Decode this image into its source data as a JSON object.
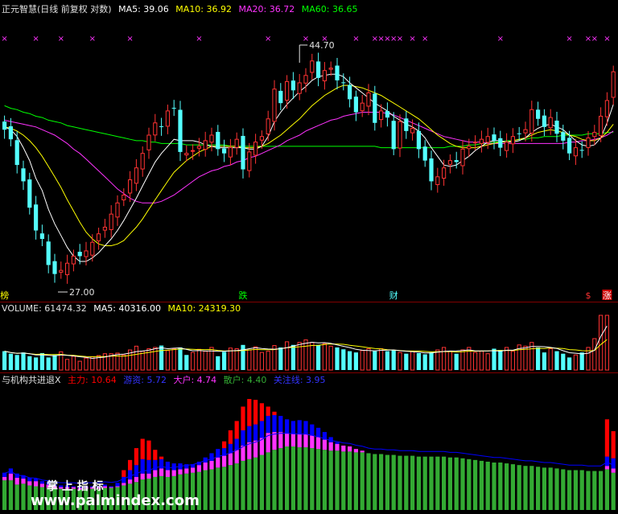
{
  "colors": {
    "up": "#ff3333",
    "down": "#54ffff",
    "ma5": "#ffffff",
    "ma10": "#ffff00",
    "ma20": "#ff33ff",
    "ma60": "#00ff00",
    "label": "#e0e0e0",
    "main": "#ff0000",
    "retail_inst": "#0000ff",
    "big": "#ff33ff",
    "small": "#33aa33",
    "focus": "#0000ff",
    "grid": "#800000"
  },
  "header_price": {
    "title": "正元智慧(日线 前复权 对数)",
    "ma5_label": "MA5: 39.06",
    "ma10_label": "MA10: 36.92",
    "ma20_label": "MA20: 36.72",
    "ma60_label": "MA60: 36.65"
  },
  "header_volume": {
    "vol_label": "VOLUME: 61474.32",
    "ma5_label": "MA5: 40316.00",
    "ma10_label": "MA10: 24319.30"
  },
  "header_indicator": {
    "title": "与机构共进退X",
    "main_label": "主力: 10.64",
    "inst_label": "游资: 5.72",
    "big_label": "大户: 4.74",
    "small_label": "散户: 4.40",
    "focus_label": "关注线: 3.95"
  },
  "chart_data": [
    {
      "type": "candlestick",
      "scale": "log",
      "ylim": [
        26.5,
        46
      ],
      "annotations": {
        "high": "44.70",
        "low": "27.00"
      },
      "event_labels": [
        {
          "index": 0,
          "text": "榜"
        },
        {
          "index": 38,
          "text": "跌"
        },
        {
          "index": 62,
          "text": "财"
        },
        {
          "index": 93,
          "text": "$"
        },
        {
          "index": 96,
          "text": "涨"
        }
      ],
      "marker_glyph": "×",
      "marker_indices": [
        0,
        5,
        9,
        14,
        20,
        31,
        42,
        48,
        51,
        56,
        59,
        60,
        61,
        62,
        63,
        65,
        67,
        79,
        90,
        93,
        94,
        96
      ],
      "close": [
        36.8,
        36.1,
        34.3,
        33.2,
        31.5,
        30.1,
        29.6,
        28.1,
        27.6,
        27.8,
        28.2,
        28.6,
        28.6,
        28.9,
        29.4,
        29.9,
        30.3,
        31.1,
        31.8,
        32.3,
        33.3,
        34.1,
        35.1,
        36.4,
        37.3,
        37.0,
        38.2,
        38.4,
        35.2,
        35.1,
        35.3,
        35.6,
        36.0,
        36.4,
        35.4,
        35.1,
        35.5,
        36.1,
        34.0,
        35.2,
        35.9,
        36.3,
        37.6,
        39.9,
        38.8,
        40.5,
        39.8,
        40.4,
        41.0,
        42.2,
        40.8,
        41.4,
        41.6,
        40.6,
        40.4,
        39.1,
        38.1,
        38.8,
        39.6,
        37.3,
        38.2,
        37.7,
        35.4,
        37.4,
        36.7,
        36.9,
        35.4,
        34.6,
        33.2,
        33.5,
        34.1,
        34.6,
        34.5,
        35.4,
        35.6,
        35.9,
        36.1,
        36.3,
        36.0,
        35.5,
        35.9,
        36.3,
        36.5,
        36.8,
        38.3,
        37.6,
        37.0,
        37.7,
        36.5,
        36.0,
        35.1,
        35.5,
        35.3,
        36.2,
        36.6,
        37.8,
        39.0,
        41.3
      ],
      "ma5": [
        37.0,
        36.8,
        36.3,
        35.5,
        34.6,
        33.4,
        32.6,
        31.4,
        30.5,
        29.8,
        29.1,
        28.6,
        28.3,
        28.3,
        28.5,
        28.8,
        29.2,
        29.6,
        30.1,
        30.7,
        31.4,
        32.1,
        32.9,
        33.7,
        34.5,
        35.1,
        35.6,
        36.1,
        36.0,
        36.0,
        36.0,
        35.9,
        35.7,
        35.6,
        35.5,
        35.5,
        35.5,
        35.5,
        35.5,
        35.4,
        35.4,
        35.6,
        36.3,
        37.4,
        38.1,
        38.7,
        39.2,
        39.7,
        40.1,
        40.6,
        40.9,
        41.0,
        41.1,
        41.1,
        40.9,
        40.4,
        40.0,
        39.6,
        39.2,
        38.8,
        38.5,
        38.2,
        37.8,
        37.5,
        37.2,
        37.0,
        36.7,
        36.2,
        35.5,
        34.9,
        34.3,
        34.2,
        34.3,
        34.6,
        34.9,
        35.3,
        35.6,
        35.9,
        36.0,
        36.0,
        35.9,
        35.9,
        36.0,
        36.2,
        36.6,
        36.9,
        37.1,
        37.2,
        37.0,
        36.8,
        36.4,
        36.0,
        35.7,
        35.6,
        35.7,
        36.2,
        37.3,
        38.7
      ],
      "ma10": [
        37.0,
        36.9,
        36.7,
        36.4,
        36.0,
        35.5,
        34.9,
        34.2,
        33.5,
        32.8,
        32.0,
        31.3,
        30.6,
        30.0,
        29.6,
        29.3,
        29.2,
        29.2,
        29.3,
        29.5,
        29.9,
        30.3,
        30.8,
        31.4,
        32.0,
        32.6,
        33.2,
        33.8,
        34.2,
        34.6,
        34.9,
        35.2,
        35.4,
        35.6,
        35.6,
        35.6,
        35.6,
        35.6,
        35.5,
        35.5,
        35.5,
        35.6,
        35.8,
        36.1,
        36.4,
        36.8,
        37.2,
        37.6,
        38.1,
        38.6,
        39.0,
        39.4,
        39.7,
        40.0,
        40.2,
        40.2,
        40.1,
        40.0,
        39.8,
        39.6,
        39.4,
        39.1,
        38.8,
        38.5,
        38.2,
        37.9,
        37.6,
        37.2,
        36.8,
        36.4,
        36.1,
        35.8,
        35.6,
        35.5,
        35.5,
        35.5,
        35.6,
        35.7,
        35.8,
        35.9,
        35.9,
        36.0,
        36.1,
        36.2,
        36.4,
        36.6,
        36.7,
        36.8,
        36.7,
        36.6,
        36.4,
        36.3,
        36.1,
        36.0,
        36.0,
        36.2,
        36.6,
        37.2
      ],
      "ma20": [
        37.5,
        37.4,
        37.3,
        37.2,
        37.1,
        37.0,
        36.8,
        36.6,
        36.4,
        36.1,
        35.8,
        35.4,
        35.1,
        34.7,
        34.3,
        33.9,
        33.5,
        33.1,
        32.7,
        32.4,
        32.1,
        31.9,
        31.8,
        31.8,
        31.8,
        31.9,
        32.1,
        32.3,
        32.6,
        32.9,
        33.2,
        33.5,
        33.7,
        33.9,
        34.0,
        34.2,
        34.3,
        34.5,
        34.6,
        34.8,
        34.9,
        35.1,
        35.3,
        35.5,
        35.7,
        36.0,
        36.2,
        36.4,
        36.7,
        36.9,
        37.1,
        37.3,
        37.5,
        37.6,
        37.8,
        37.9,
        38.0,
        38.1,
        38.1,
        38.1,
        38.1,
        38.0,
        37.9,
        37.7,
        37.5,
        37.3,
        37.1,
        36.9,
        36.7,
        36.5,
        36.3,
        36.2,
        36.1,
        36.0,
        35.9,
        35.9,
        35.9,
        35.8,
        35.8,
        35.8,
        35.8,
        35.8,
        35.8,
        35.8,
        35.8,
        35.8,
        35.8,
        35.8,
        35.8,
        35.8,
        35.9,
        35.9,
        36.0,
        36.0,
        36.1,
        36.2,
        36.4,
        36.7
      ],
      "ma60": [
        38.6,
        38.4,
        38.3,
        38.1,
        38.0,
        37.8,
        37.7,
        37.5,
        37.4,
        37.3,
        37.1,
        37.0,
        36.9,
        36.8,
        36.7,
        36.6,
        36.5,
        36.4,
        36.3,
        36.2,
        36.1,
        36.0,
        36.0,
        35.9,
        35.9,
        35.8,
        35.8,
        35.8,
        35.8,
        35.7,
        35.7,
        35.7,
        35.7,
        35.7,
        35.7,
        35.7,
        35.6,
        35.6,
        35.6,
        35.6,
        35.6,
        35.6,
        35.6,
        35.6,
        35.6,
        35.6,
        35.6,
        35.6,
        35.6,
        35.6,
        35.6,
        35.6,
        35.6,
        35.6,
        35.6,
        35.6,
        35.6,
        35.6,
        35.6,
        35.6,
        35.5,
        35.5,
        35.5,
        35.5,
        35.5,
        35.5,
        35.5,
        35.5,
        35.5,
        35.5,
        35.5,
        35.6,
        35.6,
        35.6,
        35.7,
        35.7,
        35.8,
        35.8,
        35.9,
        35.9,
        36.0,
        36.0,
        36.1,
        36.1,
        36.2,
        36.2,
        36.3,
        36.3,
        36.3,
        36.4,
        36.4,
        36.4,
        36.4,
        36.5,
        36.5,
        36.5,
        36.6,
        36.6
      ]
    },
    {
      "type": "bar",
      "name": "VOLUME",
      "ylim": [
        0,
        100
      ],
      "values": [
        30,
        26,
        24,
        28,
        22,
        20,
        27,
        20,
        24,
        29,
        17,
        22,
        14,
        19,
        21,
        23,
        26,
        26,
        27,
        24,
        32,
        38,
        30,
        34,
        36,
        39,
        31,
        34,
        36,
        24,
        28,
        33,
        30,
        36,
        22,
        29,
        35,
        34,
        40,
        32,
        37,
        28,
        30,
        39,
        36,
        45,
        40,
        44,
        48,
        44,
        40,
        42,
        38,
        36,
        33,
        30,
        28,
        31,
        34,
        30,
        34,
        30,
        32,
        28,
        26,
        30,
        27,
        25,
        28,
        32,
        36,
        30,
        26,
        32,
        36,
        28,
        30,
        26,
        34,
        32,
        36,
        30,
        40,
        38,
        44,
        36,
        28,
        34,
        30,
        26,
        20,
        24,
        28,
        36,
        50,
        130,
        108
      ]
    },
    {
      "type": "stacked_bar",
      "name": "与机构共进退X",
      "ylim": [
        0,
        15
      ],
      "small": [
        3.5,
        3.5,
        3.0,
        3.1,
        2.9,
        2.8,
        2.7,
        2.6,
        2.5,
        2.5,
        2.5,
        2.5,
        2.4,
        2.5,
        2.5,
        2.5,
        2.6,
        2.6,
        2.7,
        2.9,
        3.1,
        3.3,
        3.6,
        3.7,
        3.9,
        4.0,
        3.9,
        4.0,
        4.2,
        4.3,
        4.4,
        4.5,
        4.7,
        4.8,
        5.0,
        5.1,
        5.3,
        5.5,
        5.8,
        6.0,
        6.2,
        6.5,
        6.8,
        7.1,
        7.3,
        7.5,
        7.5,
        7.4,
        7.4,
        7.3,
        7.2,
        7.1,
        7.0,
        7.0,
        6.9,
        6.9,
        6.8,
        6.8,
        6.7,
        6.6,
        6.6,
        6.5,
        6.5,
        6.4,
        6.4,
        6.4,
        6.3,
        6.3,
        6.3,
        6.3,
        6.3,
        6.2,
        6.2,
        6.1,
        6.0,
        5.9,
        5.8,
        5.7,
        5.6,
        5.6,
        5.5,
        5.4,
        5.3,
        5.2,
        5.2,
        5.1,
        5.0,
        5.0,
        4.9,
        4.8,
        4.7,
        4.7,
        4.7,
        4.6,
        4.6,
        4.6,
        4.8,
        4.4
      ],
      "big": [
        0.4,
        0.8,
        0.8,
        0.6,
        0.5,
        0.6,
        0.4,
        0.4,
        0.3,
        0.2,
        0.2,
        0.2,
        0.2,
        0.2,
        0.2,
        0.2,
        0.2,
        0.1,
        0.1,
        0.3,
        0.5,
        0.6,
        0.7,
        0.6,
        0.8,
        0.9,
        0.8,
        0.7,
        0.6,
        0.6,
        0.6,
        0.8,
        0.9,
        1.0,
        1.2,
        1.3,
        1.4,
        1.6,
        1.8,
        2.0,
        2.0,
        2.0,
        2.3,
        2.1,
        1.9,
        1.6,
        1.5,
        1.6,
        1.6,
        1.5,
        1.4,
        1.2,
        1.0,
        0.8,
        0.7,
        0.6,
        0.4,
        0.2,
        0.0,
        0.0,
        0.0,
        0.0,
        0.0,
        0.0,
        0.0,
        0.0,
        0.0,
        0.0,
        0.0,
        0.0,
        0.0,
        0.0,
        0.0,
        0.0,
        0.0,
        0.0,
        0.0,
        0.0,
        0.0,
        0.0,
        0.0,
        0.0,
        0.0,
        0.0,
        0.0,
        0.0,
        0.0,
        0.0,
        0.0,
        0.0,
        0.0,
        0.0,
        0.0,
        0.0,
        0.0,
        0.0,
        0.4,
        0.5
      ],
      "inst": [
        0.5,
        0.6,
        0.5,
        0.4,
        0.4,
        0.3,
        0.3,
        0.3,
        0.2,
        0.2,
        0.2,
        0.1,
        0.1,
        0.1,
        0.1,
        0.1,
        0.2,
        0.1,
        0.4,
        0.7,
        1.1,
        1.4,
        1.7,
        1.6,
        1.2,
        1.1,
        1.0,
        0.8,
        0.7,
        0.5,
        0.4,
        0.4,
        0.6,
        0.9,
        1.0,
        0.9,
        1.1,
        1.3,
        1.8,
        1.9,
        1.9,
        2.0,
        2.0,
        2.0,
        1.9,
        1.6,
        1.5,
        1.6,
        1.5,
        1.3,
        1.1,
        0.9,
        0.6,
        0.2,
        0.0,
        0.0,
        0.0,
        0.0,
        0.0,
        0.0,
        0.0,
        0.0,
        0.0,
        0.0,
        0.0,
        0.0,
        0.0,
        0.0,
        0.0,
        0.0,
        0.0,
        0.0,
        0.0,
        0.0,
        0.0,
        0.0,
        0.0,
        0.0,
        0.0,
        0.0,
        0.0,
        0.0,
        0.0,
        0.0,
        0.0,
        0.0,
        0.0,
        0.0,
        0.0,
        0.0,
        0.0,
        0.0,
        0.0,
        0.0,
        0.0,
        0.0,
        1.1,
        1.2
      ],
      "main": [
        0,
        0,
        0,
        0,
        0,
        0,
        0,
        0,
        0,
        0,
        0,
        0,
        0,
        0,
        0,
        0,
        0,
        0,
        0,
        0.8,
        1.2,
        2.0,
        2.4,
        2.3,
        1.2,
        0.3,
        0,
        0,
        0,
        0,
        0,
        0,
        0,
        0,
        0,
        0.8,
        1.6,
        2.1,
        2.8,
        3.2,
        2.9,
        2.1,
        1.1,
        0.4,
        0,
        0,
        0,
        0,
        0,
        0,
        0,
        0,
        0,
        0,
        0,
        0,
        0,
        0,
        0,
        0,
        0,
        0,
        0,
        0,
        0,
        0,
        0,
        0,
        0,
        0,
        0,
        0,
        0,
        0,
        0,
        0,
        0,
        0,
        0,
        0,
        0,
        0,
        0,
        0,
        0,
        0,
        0,
        0,
        0,
        0,
        0,
        0,
        0,
        0,
        0,
        0,
        4.4,
        3.2
      ]
    }
  ],
  "watermark": {
    "line1": "掌 上 指 标",
    "line2": "www.palmindex.com"
  }
}
